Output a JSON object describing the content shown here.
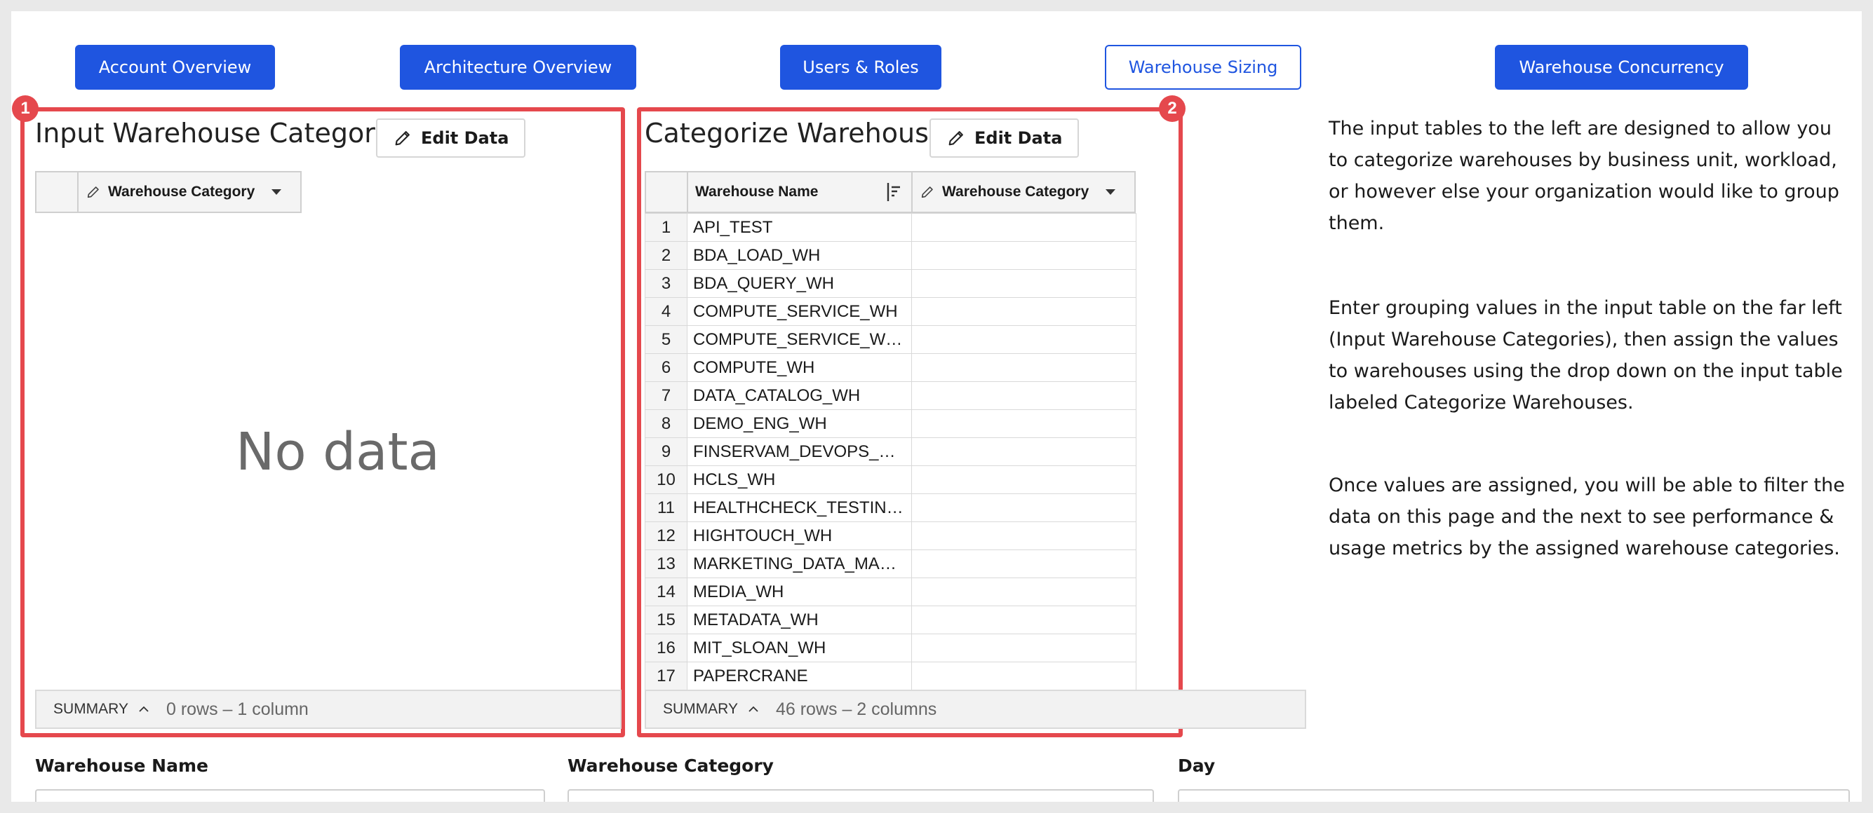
{
  "nav": {
    "buttons": [
      {
        "label": "Account Overview",
        "active": false
      },
      {
        "label": "Architecture Overview",
        "active": false
      },
      {
        "label": "Users & Roles",
        "active": false
      },
      {
        "label": "Warehouse Sizing",
        "active": true
      },
      {
        "label": "Warehouse Concurrency",
        "active": false
      }
    ]
  },
  "panel1": {
    "badge": "1",
    "title": "Input Warehouse Categories",
    "edit_label": "Edit Data",
    "column_header": "Warehouse Category",
    "empty_text": "No data",
    "summary_label": "SUMMARY",
    "summary_count": "0 rows – 1 column"
  },
  "panel2": {
    "badge": "2",
    "title": "Categorize Warehouses",
    "edit_label": "Edit Data",
    "columns": [
      "Warehouse Name",
      "Warehouse Category"
    ],
    "rows": [
      {
        "n": "1",
        "name": "API_TEST",
        "category": ""
      },
      {
        "n": "2",
        "name": "BDA_LOAD_WH",
        "category": ""
      },
      {
        "n": "3",
        "name": "BDA_QUERY_WH",
        "category": ""
      },
      {
        "n": "4",
        "name": "COMPUTE_SERVICE_WH",
        "category": ""
      },
      {
        "n": "5",
        "name": "COMPUTE_SERVICE_WH_...",
        "category": ""
      },
      {
        "n": "6",
        "name": "COMPUTE_WH",
        "category": ""
      },
      {
        "n": "7",
        "name": "DATA_CATALOG_WH",
        "category": ""
      },
      {
        "n": "8",
        "name": "DEMO_ENG_WH",
        "category": ""
      },
      {
        "n": "9",
        "name": "FINSERVAM_DEVOPS_WH",
        "category": ""
      },
      {
        "n": "10",
        "name": "HCLS_WH",
        "category": ""
      },
      {
        "n": "11",
        "name": "HEALTHCHECK_TESTING_...",
        "category": ""
      },
      {
        "n": "12",
        "name": "HIGHTOUCH_WH",
        "category": ""
      },
      {
        "n": "13",
        "name": "MARKETING_DATA_MADN...",
        "category": ""
      },
      {
        "n": "14",
        "name": "MEDIA_WH",
        "category": ""
      },
      {
        "n": "15",
        "name": "METADATA_WH",
        "category": ""
      },
      {
        "n": "16",
        "name": "MIT_SLOAN_WH",
        "category": ""
      },
      {
        "n": "17",
        "name": "PAPERCRANE",
        "category": ""
      }
    ],
    "summary_label": "SUMMARY",
    "summary_count": "46 rows – 2 columns"
  },
  "description": {
    "paragraphs": [
      "The input tables to the left are designed to allow you to categorize warehouses by business unit, workload, or however else your organization would like to group them.",
      "Enter grouping values in the input table on the far left (Input Warehouse Categories), then assign the values to warehouses using the drop down on the input table labeled Categorize Warehouses.",
      "Once values are assigned, you will be able to filter the data on this page and the next to see performance & usage metrics by the assigned warehouse categories."
    ]
  },
  "filters": {
    "labels": [
      "Warehouse Name",
      "Warehouse Category",
      "Day"
    ]
  },
  "colors": {
    "accent": "#1f55e0",
    "highlight": "#e5484d"
  },
  "icons": [
    "pencil-icon",
    "caret-down-icon",
    "sort-icon",
    "chevron-up-icon"
  ]
}
